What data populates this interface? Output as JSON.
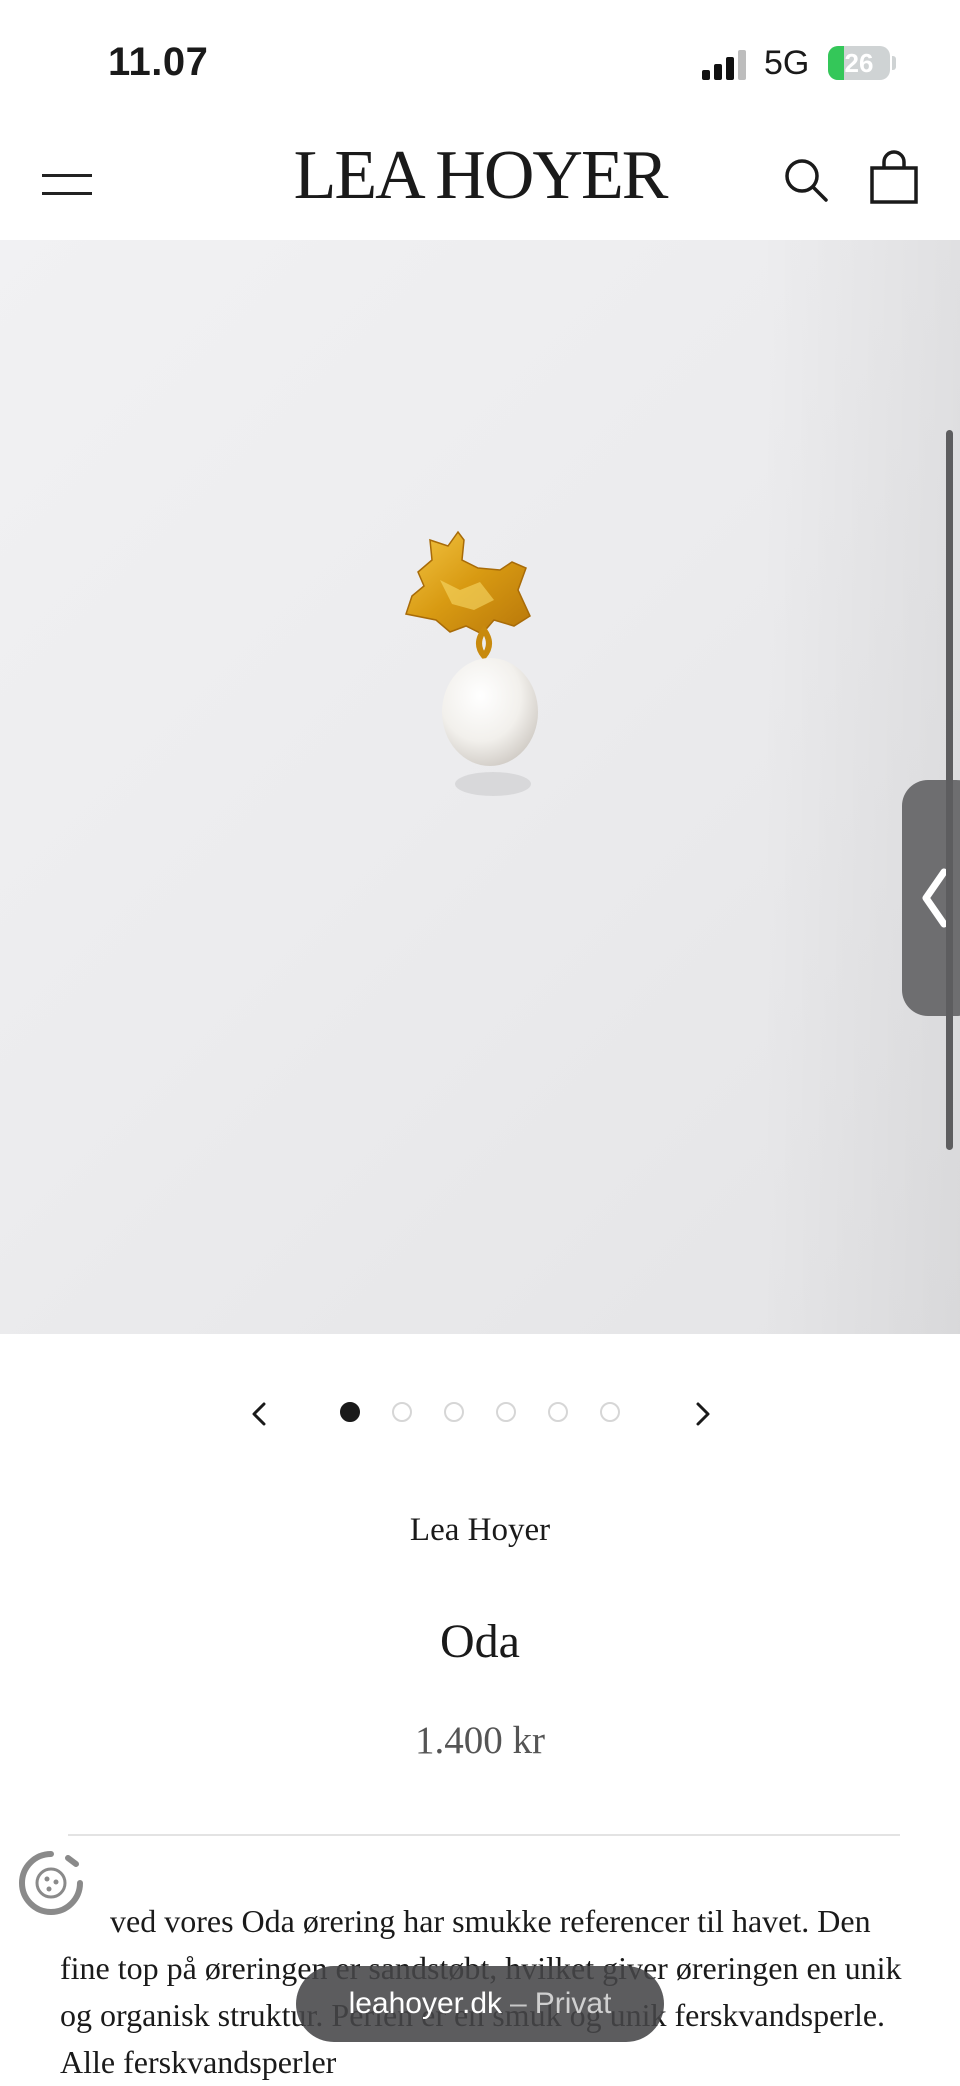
{
  "status_bar": {
    "time": "11.07",
    "network": "5G",
    "battery": "26",
    "battery_level_percent": 26,
    "battery_color": "#34c759"
  },
  "header": {
    "logo": "LEA HOYER",
    "menu_icon": "hamburger-icon",
    "search_icon": "search-icon",
    "cart_icon": "shopping-bag-icon"
  },
  "gallery": {
    "image_alt": "Gold earring with freshwater pearl",
    "dot_count": 6,
    "active_dot": 1
  },
  "product": {
    "brand": "Lea Hoyer",
    "name": "Oda",
    "price": "1.400 kr",
    "description": "ved vores Oda ørering har smukke referencer til havet. Den fine top på øreringen er sandstøbt, hvilket giver øreringen en unik og organisk struktur. Perlen er en smuk og unik ferskvandsperle. Alle ferskvandsperler"
  },
  "browser": {
    "domain": "leahoyer.dk",
    "separator": "–",
    "mode": "Privat"
  }
}
